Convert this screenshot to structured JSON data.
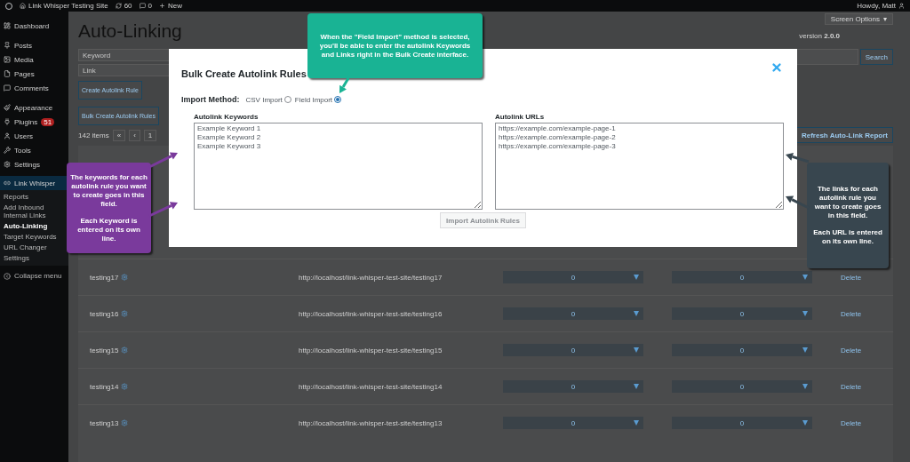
{
  "admin_bar": {
    "site_name": "Link Whisper Testing Site",
    "updates": "60",
    "comments": "0",
    "new": "New",
    "greeting": "Howdy, Matt"
  },
  "sidebar": {
    "items": [
      {
        "label": "Dashboard",
        "selected": false
      },
      {
        "label": "Posts",
        "selected": false
      },
      {
        "label": "Media",
        "selected": false
      },
      {
        "label": "Pages",
        "selected": false
      },
      {
        "label": "Comments",
        "selected": false
      },
      {
        "label": "Appearance",
        "selected": false
      },
      {
        "label": "Plugins",
        "selected": false,
        "badge": "51"
      },
      {
        "label": "Users",
        "selected": false
      },
      {
        "label": "Tools",
        "selected": false
      },
      {
        "label": "Settings",
        "selected": false
      },
      {
        "label": "Link Whisper",
        "selected": true
      }
    ],
    "submenu": [
      {
        "label": "Reports",
        "selected": false
      },
      {
        "label": "Add Inbound Internal Links",
        "selected": false
      },
      {
        "label": "Auto-Linking",
        "selected": true
      },
      {
        "label": "Target Keywords",
        "selected": false
      },
      {
        "label": "URL Changer",
        "selected": false
      },
      {
        "label": "Settings",
        "selected": false
      }
    ],
    "collapse": "Collapse menu"
  },
  "page": {
    "title": "Auto-Linking",
    "version_label": "version",
    "version": "2.0.0",
    "screen_options": "Screen Options",
    "screen_options_caret": "▾",
    "keyword_placeholder": "Keyword",
    "link_placeholder": "Link",
    "create_button": "Create Autolink Rule",
    "bulk_button": "Bulk Create Autolink Rules",
    "search_button": "Search",
    "items_count": "142 items",
    "pagination": [
      "«",
      "‹",
      "1"
    ],
    "refresh_button": "Refresh Auto-Link Report"
  },
  "table": {
    "rows": [
      {
        "keyword": "testing17",
        "url": "http://localhost/link-whisper-test-site/testing17",
        "column_3": "0",
        "column_4": "0",
        "action": "Delete"
      },
      {
        "keyword": "testing16",
        "url": "http://localhost/link-whisper-test-site/testing16",
        "column_3": "0",
        "column_4": "0",
        "action": "Delete"
      },
      {
        "keyword": "testing15",
        "url": "http://localhost/link-whisper-test-site/testing15",
        "column_3": "0",
        "column_4": "0",
        "action": "Delete"
      },
      {
        "keyword": "testing14",
        "url": "http://localhost/link-whisper-test-site/testing14",
        "column_3": "0",
        "column_4": "0",
        "action": "Delete"
      },
      {
        "keyword": "testing13",
        "url": "http://localhost/link-whisper-test-site/testing13",
        "column_3": "0",
        "column_4": "0",
        "action": "Delete"
      }
    ]
  },
  "modal": {
    "title": "Bulk Create Autolink Rules",
    "import_method_label": "Import Method:",
    "options": [
      {
        "label": "CSV Import",
        "selected": false
      },
      {
        "label": "Field Import",
        "selected": true
      }
    ],
    "fields": [
      {
        "label": "Autolink Keywords",
        "value": "Example Keyword 1\nExample Keyword 2\nExample Keyword 3"
      },
      {
        "label": "Autolink URLs",
        "value": "https://example.com/example-page-1\nhttps://example.com/example-page-2\nhttps://example.com/example-page-3"
      }
    ],
    "import_button": {
      "label": "Import Autolink Rules",
      "disabled": true
    }
  },
  "callouts": [
    {
      "paragraphs": [
        "When the \"Field Import\" method is selected, you'll be able to enter the autolink Keywords and Links right in the Bulk Create interface."
      ],
      "color": "#19b394"
    },
    {
      "paragraphs": [
        "The keywords for each autolink rule you want to create goes in this field.",
        "Each Keyword is entered on its own line."
      ],
      "color": "#7a3a9c"
    },
    {
      "paragraphs": [
        "The links for each autolink rule you want to create goes in this field.",
        "Each URL is entered on its own line."
      ],
      "color": "#38464f"
    }
  ]
}
